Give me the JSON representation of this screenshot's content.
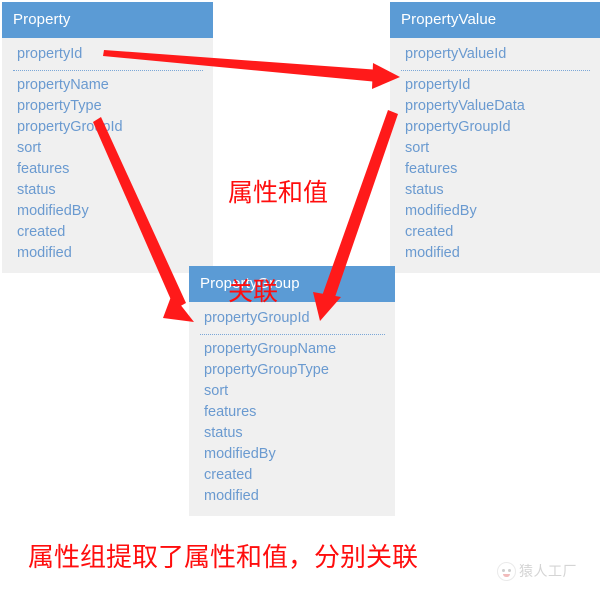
{
  "diagram": {
    "type": "entity-relationship-diagram",
    "accent_color": "#5b9bd5",
    "field_text_color": "#6a9ad0",
    "body_color": "#f0f0f0",
    "annotation_color": "#ff0d0d"
  },
  "entities": [
    {
      "name": "Property",
      "primary_key": "propertyId",
      "fields": [
        "propertyName",
        "propertyType",
        "propertyGroupId",
        "sort",
        "features",
        "status",
        "modifiedBy",
        "created",
        "modified"
      ]
    },
    {
      "name": "PropertyValue",
      "primary_key": "propertyValueId",
      "fields": [
        "propertyId",
        "propertyValueData",
        "propertyGroupId",
        "sort",
        "features",
        "status",
        "modifiedBy",
        "created",
        "modified"
      ]
    },
    {
      "name": "PropertyGroup",
      "primary_key": "propertyGroupId",
      "fields": [
        "propertyGroupName",
        "propertyGroupType",
        "sort",
        "features",
        "status",
        "modifiedBy",
        "created",
        "modified"
      ]
    }
  ],
  "relationships": [
    {
      "from": "Property.propertyId",
      "to": "PropertyValue.propertyId"
    },
    {
      "from": "Property.propertyGroupId",
      "to": "PropertyGroup.propertyGroupId"
    },
    {
      "from": "PropertyValue.propertyGroupId",
      "to": "PropertyGroup.propertyGroupId"
    }
  ],
  "annotations": {
    "middle_line1": "属性和值",
    "middle_line2": "关联",
    "bottom": "属性组提取了属性和值，分别关联"
  },
  "watermark": {
    "text": "猿人工厂"
  }
}
